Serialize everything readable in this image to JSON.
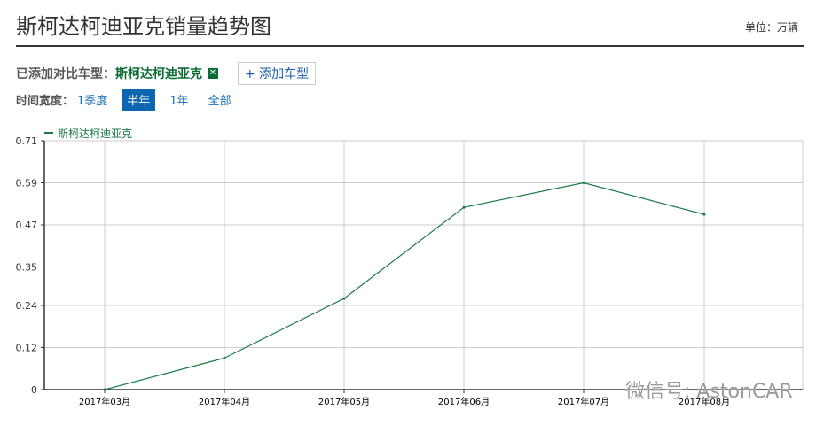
{
  "header": {
    "title": "斯柯达柯迪亚克销量趋势图",
    "unit": "单位：万辆"
  },
  "compare": {
    "label": "已添加对比车型：",
    "model": "斯柯达柯迪亚克",
    "remove_icon": "close-icon",
    "add_button": "+ 添加车型"
  },
  "time_range": {
    "label": "时间宽度：",
    "options": [
      "1季度",
      "半年",
      "1年",
      "全部"
    ],
    "selected": "半年"
  },
  "watermark": "微信号: AstonCAR",
  "chart_data": {
    "type": "line",
    "title": "斯柯达柯迪亚克销量趋势图",
    "ylabel": "万辆",
    "categories": [
      "2017年03月",
      "2017年04月",
      "2017年05月",
      "2017年06月",
      "2017年07月",
      "2017年08月"
    ],
    "series": [
      {
        "name": "斯柯达柯迪亚克",
        "color": "#1e7a45",
        "values": [
          0,
          0.09,
          0.26,
          0.52,
          0.59,
          0.5
        ]
      }
    ],
    "yticks": [
      "0",
      "0.12",
      "0.24",
      "0.35",
      "0.47",
      "0.59",
      "0.71"
    ],
    "ylim": [
      0,
      0.71
    ],
    "grid": true,
    "legend": "top-left"
  }
}
